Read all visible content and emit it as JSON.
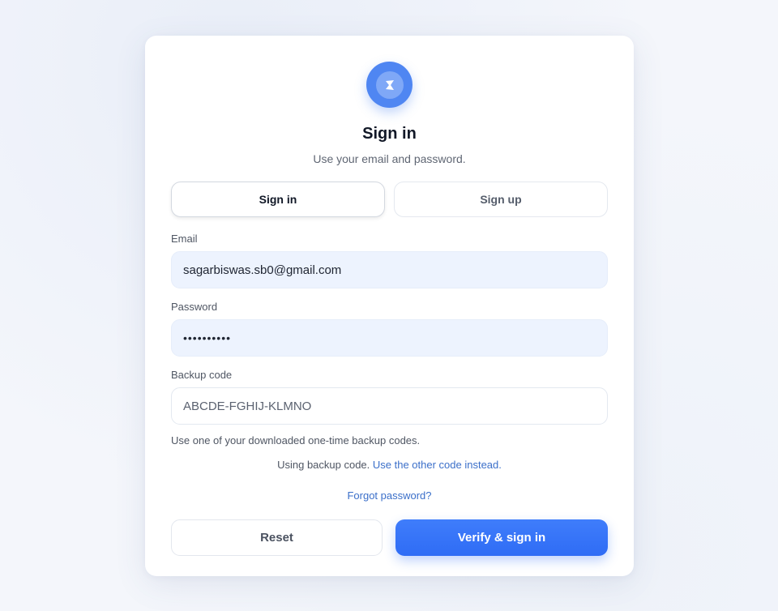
{
  "header": {
    "logo_icon": "app-logo-icon",
    "title": "Sign in",
    "subtitle": "Use your email and password."
  },
  "tabs": [
    {
      "label": "Sign in",
      "active": true
    },
    {
      "label": "Sign up",
      "active": false
    }
  ],
  "form": {
    "email": {
      "label": "Email",
      "value": "sagarbiswas.sb0@gmail.com"
    },
    "password": {
      "label": "Password",
      "value": "••••••••••"
    },
    "backup_code": {
      "label": "Backup code",
      "placeholder": "ABCDE-FGHIJ-KLMNO",
      "hint": "Use one of your downloaded one-time backup codes."
    }
  },
  "switch": {
    "prefix": "Using backup code. ",
    "link": "Use the other code instead."
  },
  "forgot_link": "Forgot password?",
  "actions": {
    "reset_label": "Reset",
    "verify_label": "Verify & sign in"
  },
  "colors": {
    "accent": "#2f6cf5",
    "link": "#3b6fc9",
    "filled_field_bg": "#edf3fe"
  }
}
